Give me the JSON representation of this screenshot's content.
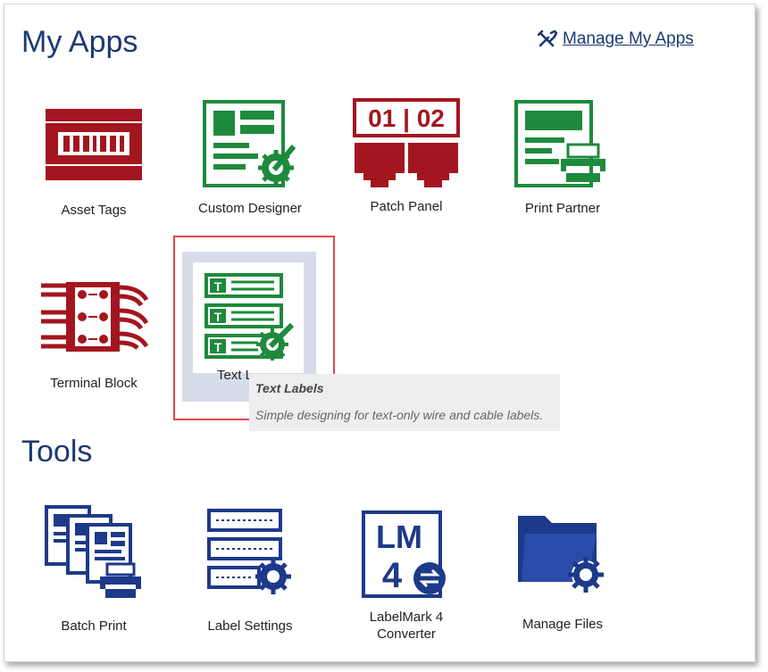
{
  "sections": {
    "my_apps": "My Apps",
    "tools": "Tools"
  },
  "manage_link": {
    "label": "Manage My Apps",
    "icon": "tools-icon"
  },
  "colors": {
    "red": "#a3161f",
    "green": "#1e8a3c",
    "blue": "#1d3a8a",
    "title": "#1b3a73",
    "highlight": "#e0484e"
  },
  "apps": [
    {
      "label": "Asset Tags",
      "icon": "asset-tags-icon"
    },
    {
      "label": "Custom Designer",
      "icon": "custom-designer-icon"
    },
    {
      "label": "Patch Panel",
      "icon": "patch-panel-icon",
      "icon_text": "01 | 02"
    },
    {
      "label": "Print Partner",
      "icon": "print-partner-icon"
    },
    {
      "label": "Terminal Block",
      "icon": "terminal-block-icon"
    },
    {
      "label": "Text L",
      "icon": "text-labels-icon"
    }
  ],
  "tooltip": {
    "title": "Text Labels",
    "description": "Simple designing for text-only wire and cable labels."
  },
  "tools": [
    {
      "label": "Batch Print",
      "icon": "batch-print-icon"
    },
    {
      "label": "Label Settings",
      "icon": "label-settings-icon"
    },
    {
      "label": "LabelMark 4",
      "label2": "Converter",
      "icon": "labelmark-converter-icon",
      "icon_text1": "LM",
      "icon_text2": "4"
    },
    {
      "label": "Manage Files",
      "icon": "manage-files-icon"
    }
  ]
}
